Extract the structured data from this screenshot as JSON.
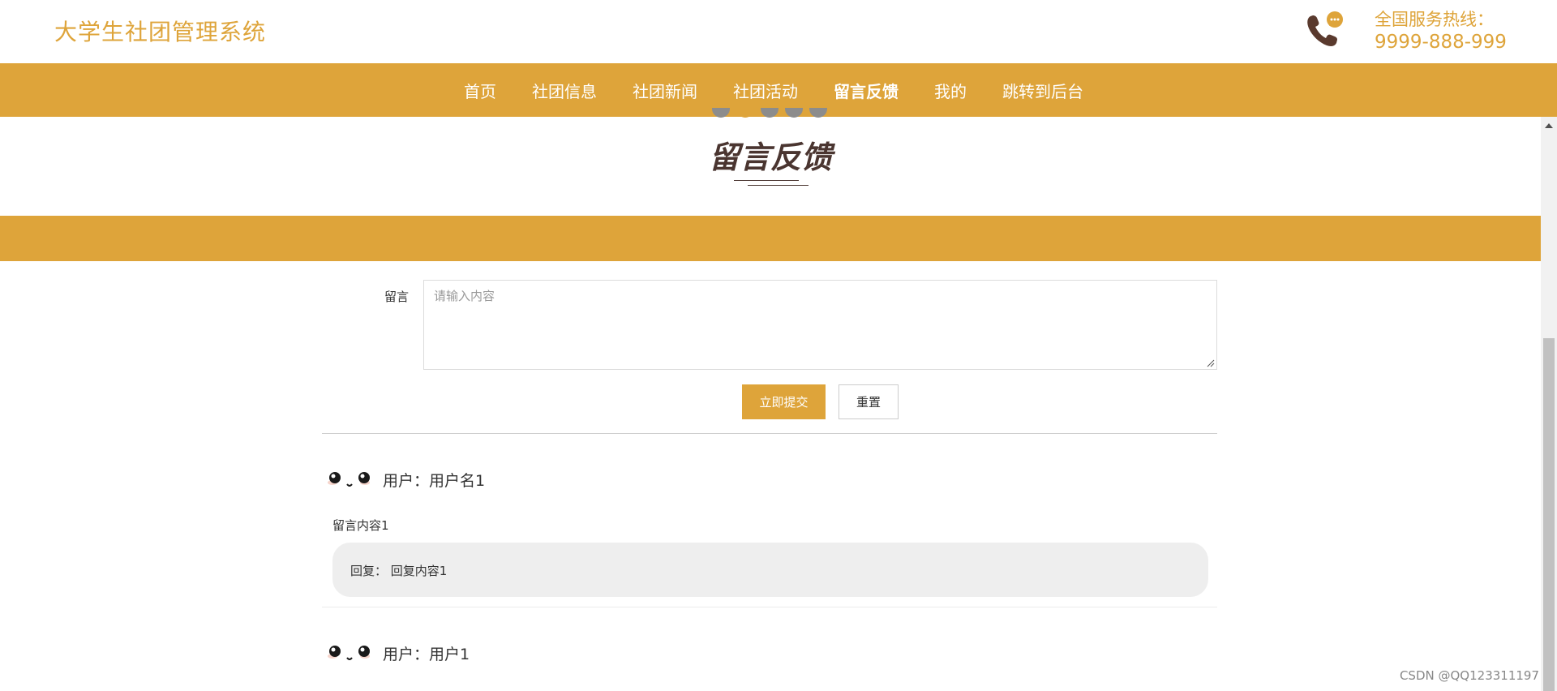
{
  "header": {
    "site_title": "大学生社团管理系统",
    "hotline_label": "全国服务热线：",
    "hotline_number": "9999-888-999"
  },
  "nav": {
    "items": [
      {
        "label": "首页"
      },
      {
        "label": "社团信息"
      },
      {
        "label": "社团新闻"
      },
      {
        "label": "社团活动"
      },
      {
        "label": "留言反馈"
      },
      {
        "label": "我的"
      },
      {
        "label": "跳转到后台"
      }
    ],
    "active_index": 4
  },
  "carousel": {
    "dot_count": 5,
    "active_dot": 2
  },
  "section": {
    "title": "留言反馈"
  },
  "form": {
    "label": "留言",
    "placeholder": "请输入内容",
    "value": "",
    "submit_label": "立即提交",
    "reset_label": "重置"
  },
  "messages": [
    {
      "user_prefix": "用户：",
      "user": "用户名1",
      "content": "留言内容1",
      "reply_prefix": "回复：",
      "reply": "回复内容1"
    },
    {
      "user_prefix": "用户：",
      "user": "用户1"
    }
  ],
  "watermark": "CSDN @QQ123311197",
  "colors": {
    "accent": "#dea43a",
    "title": "#4a3530",
    "reply_bg": "#eeeeee"
  },
  "icons": [
    "phone-chat-icon",
    "avatar-face-icon",
    "scroll-up-arrow-icon",
    "textarea-resize-grip-icon"
  ]
}
